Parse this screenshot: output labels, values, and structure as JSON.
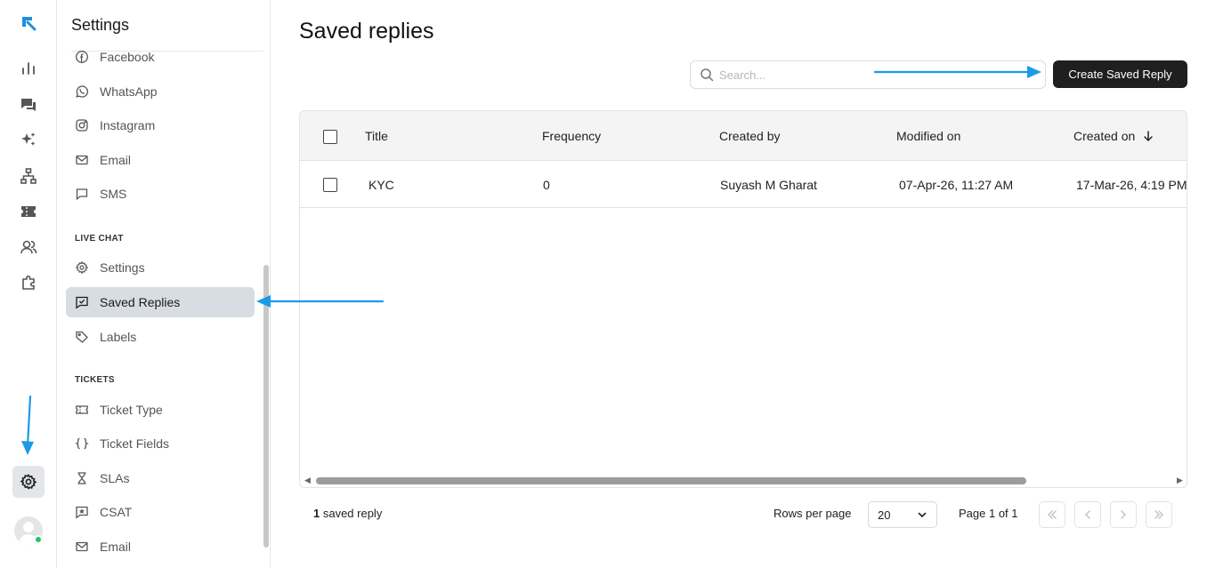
{
  "rail": {
    "icons": [
      "logo-icon",
      "analytics-icon",
      "conversations-icon",
      "ai-sparkle-icon",
      "workflow-icon",
      "tickets-icon",
      "contacts-icon",
      "integrations-icon"
    ],
    "bottom": [
      "settings-icon",
      "avatar"
    ]
  },
  "settings": {
    "title": "Settings",
    "channels": [
      {
        "label": "Facebook",
        "icon": "facebook-icon"
      },
      {
        "label": "WhatsApp",
        "icon": "whatsapp-icon"
      },
      {
        "label": "Instagram",
        "icon": "instagram-icon"
      },
      {
        "label": "Email",
        "icon": "email-icon"
      },
      {
        "label": "SMS",
        "icon": "sms-icon"
      }
    ],
    "live_chat_label": "LIVE CHAT",
    "live_chat": [
      {
        "label": "Settings",
        "icon": "gear-icon"
      },
      {
        "label": "Saved Replies",
        "icon": "saved-reply-icon"
      },
      {
        "label": "Labels",
        "icon": "tag-icon"
      }
    ],
    "tickets_label": "TICKETS",
    "tickets": [
      {
        "label": "Ticket Type",
        "icon": "ticket-icon"
      },
      {
        "label": "Ticket Fields",
        "icon": "braces-icon"
      },
      {
        "label": "SLAs",
        "icon": "hourglass-icon"
      },
      {
        "label": "CSAT",
        "icon": "star-icon"
      },
      {
        "label": "Email",
        "icon": "email-icon"
      }
    ]
  },
  "main": {
    "title": "Saved replies",
    "search_placeholder": "Search...",
    "create_label": "Create Saved Reply",
    "columns": [
      "Title",
      "Frequency",
      "Created by",
      "Modified on",
      "Created on"
    ],
    "rows": [
      {
        "title": "KYC",
        "frequency": "0",
        "created_by": "Suyash M Gharat",
        "modified_on": "07-Apr-26, 11:27 AM",
        "created_on": "17-Mar-26, 4:19 PM"
      }
    ],
    "footer": {
      "count": "1",
      "count_suffix": " saved reply",
      "rows_per_page_label": "Rows per page",
      "rows_per_page_value": "20",
      "page_label": "Page 1 of 1"
    }
  },
  "colors": {
    "accent_arrow": "#1a9be8",
    "primary_button": "#1f1f1f",
    "active_nav": "#d7dde2",
    "status_online": "#22c55e",
    "logo": "#1f8fe0"
  }
}
